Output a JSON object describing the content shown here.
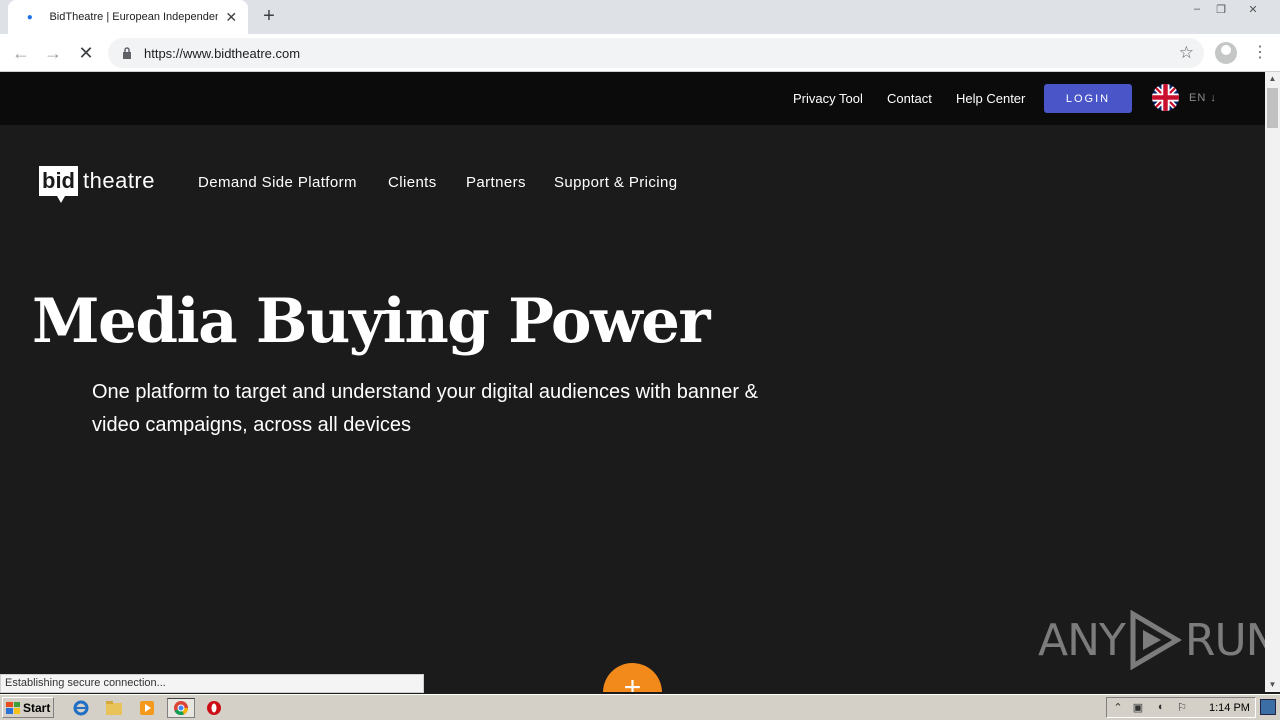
{
  "browser": {
    "tab_title": "BidTheatre | European Independent",
    "tab_close": "✕",
    "new_tab": "+",
    "url": "https://www.bidtheatre.com",
    "window_controls": [
      "–",
      "❐",
      "✕"
    ]
  },
  "topbar": {
    "links": [
      "Privacy Tool",
      "Contact",
      "Help Center"
    ],
    "login_label": "LOGIN",
    "language": "EN ↓"
  },
  "logo": {
    "bid": "bid",
    "theatre": "theatre"
  },
  "nav": {
    "items": [
      "Demand Side Platform",
      "Clients",
      "Partners",
      "Support & Pricing"
    ]
  },
  "hero": {
    "title": "Media Buying Power",
    "subtitle": "One platform to target and understand your digital audiences with banner & video campaigns, across all devices"
  },
  "fab_label": "+",
  "watermark": {
    "left": "ANY",
    "right": "RUN"
  },
  "status_text": "Establishing secure connection...",
  "taskbar": {
    "start_label": "Start",
    "clock": "1:14 PM"
  },
  "colors": {
    "page_bg": "#1b1b1c",
    "topbar_bg": "#0b0b0b",
    "login_bg": "#4a55c8",
    "fab": "#f28a1b"
  },
  "icons": [
    "loading-spinner-icon",
    "close-icon",
    "plus-icon",
    "back-arrow-icon",
    "forward-arrow-icon",
    "stop-icon",
    "lock-icon",
    "star-icon",
    "profile-icon",
    "kebab-menu-icon",
    "uk-flag-icon",
    "windows-logo-icon",
    "ie-icon",
    "explorer-folder-icon",
    "media-player-icon",
    "chrome-icon",
    "opera-icon"
  ]
}
